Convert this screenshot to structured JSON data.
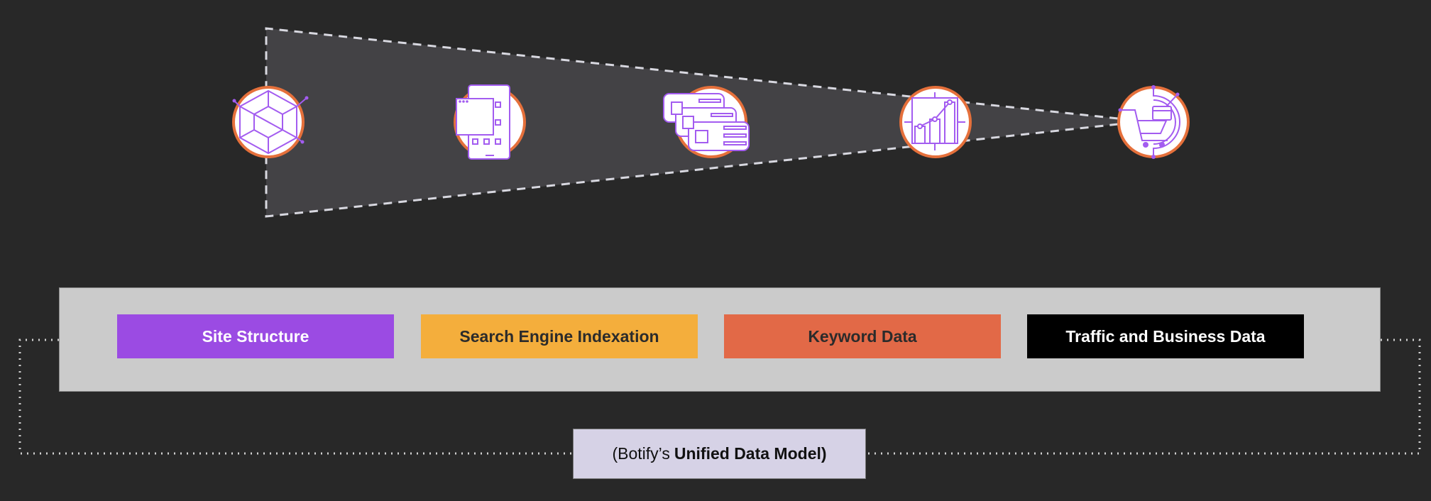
{
  "diagram": {
    "stages": [
      {
        "name": "site-structure",
        "icon": "hexagon-structure-icon"
      },
      {
        "name": "mobile-rendering",
        "icon": "mobile-pages-icon"
      },
      {
        "name": "indexation",
        "icon": "stacked-cards-icon"
      },
      {
        "name": "keyword-ranking",
        "icon": "growth-chart-icon"
      },
      {
        "name": "conversion",
        "icon": "shopping-cart-icon"
      }
    ],
    "categories": [
      {
        "label": "Site Structure",
        "bg": "#9b4be3",
        "fg": "#ffffff"
      },
      {
        "label": "Search Engine Indexation",
        "bg": "#f4ae3c",
        "fg": "#2b2b2b"
      },
      {
        "label": "Keyword Data",
        "bg": "#e26947",
        "fg": "#2b2b2b"
      },
      {
        "label": "Traffic and Business Data",
        "bg": "#000000",
        "fg": "#ffffff"
      }
    ],
    "footer": {
      "prefix": "(Botify’s",
      "bold": "Unified Data Model)"
    },
    "colors": {
      "icon_stroke": "#a35cf0",
      "icon_ring": "#e5703b",
      "funnel_fill": "#434245",
      "funnel_stroke": "#d8d8e0"
    }
  }
}
